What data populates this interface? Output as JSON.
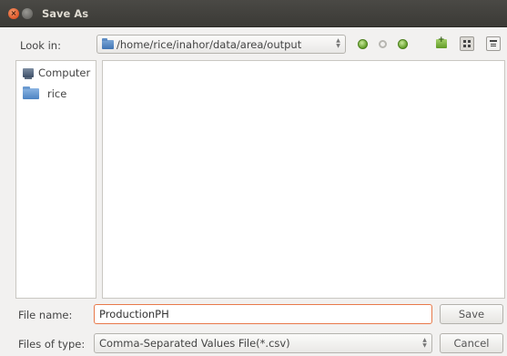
{
  "window": {
    "title": "Save As",
    "close_glyph": "×"
  },
  "toolbar": {
    "look_in_label": "Look in:",
    "path": "/home/rice/inahor/data/area/output",
    "combo_arrows": "⌃⌄",
    "icons": [
      "back-icon",
      "forward-icon",
      "parent-directory-icon",
      "new-folder-icon",
      "list-view-icon",
      "detail-view-icon"
    ]
  },
  "sidebar": {
    "items": [
      {
        "label": "Computer",
        "icon": "computer-icon"
      },
      {
        "label": "rice",
        "icon": "home-folder-icon"
      }
    ]
  },
  "form": {
    "file_name_label": "File name:",
    "file_name_value": "ProductionPH",
    "save_label": "Save",
    "files_of_type_label": "Files of type:",
    "files_of_type_value": "Comma-Separated Values File(*.csv)",
    "cancel_label": "Cancel"
  },
  "colors": {
    "titlebar": "#3c3b37",
    "close_button": "#e0582a",
    "focus_border": "#e8794a",
    "accent_green": "#5d9a24"
  }
}
